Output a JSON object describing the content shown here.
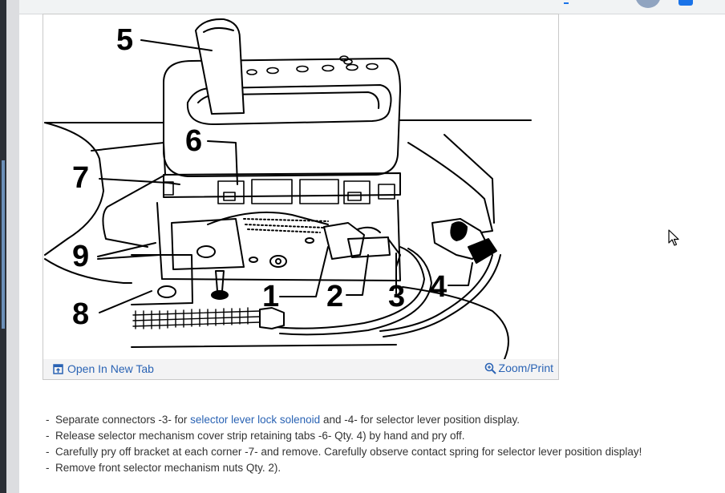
{
  "figure": {
    "callouts": [
      "5",
      "6",
      "7",
      "9",
      "8",
      "1",
      "2",
      "3",
      "4"
    ],
    "open_tab_label": "Open In New Tab",
    "zoom_label": "Zoom/Print",
    "icons": {
      "open_tab": "open-in-new-tab-icon",
      "zoom": "magnifier-zoom-icon"
    }
  },
  "steps": [
    {
      "before": "Separate connectors -3- for ",
      "link": "selector lever lock solenoid",
      "after": " and -4- for selector lever position display."
    },
    {
      "before": "Release selector mechanism cover strip retaining tabs -6- Qty. 4) by hand and pry off.",
      "link": "",
      "after": ""
    },
    {
      "before": "Carefully pry off bracket at each corner -7- and remove. Carefully observe contact spring for selector lever position display!",
      "link": "",
      "after": ""
    },
    {
      "before": "Remove front selector mechanism nuts Qty. 2).",
      "link": "",
      "after": ""
    }
  ],
  "colors": {
    "link": "#2a63b4",
    "text": "#333333",
    "accent": "#1a73e8"
  }
}
